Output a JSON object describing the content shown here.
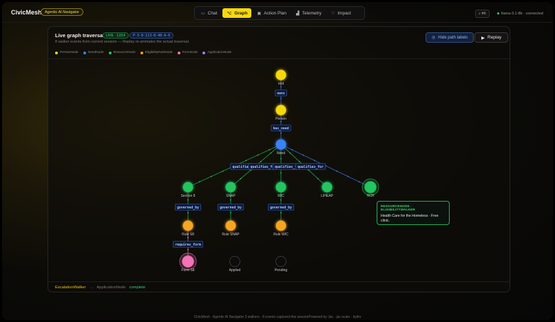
{
  "app": {
    "name": "CivicMesh",
    "badge": "Agentic AI Navigator"
  },
  "nav": {
    "tabs": [
      {
        "label": "Chat",
        "icon": "chat-icon",
        "active": false
      },
      {
        "label": "Graph",
        "icon": "graph-icon",
        "active": true
      },
      {
        "label": "Action Plan",
        "icon": "plan-icon",
        "active": false
      },
      {
        "label": "Telemetry",
        "icon": "bar-chart-icon",
        "active": false
      },
      {
        "label": "Impact",
        "icon": "heart-icon",
        "active": false
      }
    ]
  },
  "shortcut": "⌘K",
  "model_status": "llama-3.1-8b · connected",
  "panel": {
    "title": "Live graph traversal",
    "live_chip": "LIVE · 12/14",
    "id_chip": "P-3-8-113-8-48-A-6",
    "subtitle": "8 walker events from current session — Replay re-animates the actual traversal.",
    "hide_labels_button": "Hide path labels",
    "replay_button": "Replay"
  },
  "legend": [
    {
      "label": "PersonNode",
      "color": "#f5d90a"
    },
    {
      "label": "NeedNode",
      "color": "#3b82f6"
    },
    {
      "label": "ResourceNode",
      "color": "#22c55e"
    },
    {
      "label": "EligibilityRuleNode",
      "color": "#f59e0b"
    },
    {
      "label": "FormNode",
      "color": "#f472b6"
    },
    {
      "label": "ApplicationNode",
      "color": "#8b8bf5"
    }
  ],
  "graph": {
    "nodes": [
      {
        "id": "root",
        "label": "root",
        "kind": "person"
      },
      {
        "id": "person",
        "label": "Person",
        "kind": "person"
      },
      {
        "id": "need",
        "label": "Need",
        "kind": "need"
      },
      {
        "id": "sec8",
        "label": "Section 8",
        "kind": "resource"
      },
      {
        "id": "snap",
        "label": "SNAP",
        "kind": "resource"
      },
      {
        "id": "wic",
        "label": "WIC",
        "kind": "resource"
      },
      {
        "id": "liheap",
        "label": "LIHEAP",
        "kind": "resource"
      },
      {
        "id": "hch",
        "label": "HCH",
        "kind": "resource-active"
      },
      {
        "id": "rule8",
        "label": "Rule S8",
        "kind": "rule"
      },
      {
        "id": "rulesnap",
        "label": "Rule SNAP",
        "kind": "rule"
      },
      {
        "id": "rulewic",
        "label": "Rule WIC",
        "kind": "rule"
      },
      {
        "id": "form8",
        "label": "Form S8",
        "kind": "form-active"
      },
      {
        "id": "applied",
        "label": "Applied",
        "kind": "pending"
      },
      {
        "id": "pending",
        "label": "Pending",
        "kind": "pending"
      }
    ],
    "edge_labels": {
      "root_person": "owns",
      "person_need": "has_need",
      "qualifies": [
        "qualifies_",
        "qualifies_fo",
        "qualifies_f",
        "qualifies_for"
      ],
      "governed_by": "governed_by",
      "requires_form": "requires_form"
    }
  },
  "tooltip": {
    "heading": "RESOURCENODE · ELIGIBILITYWALKER",
    "body": "Health Care for the Homeless · Free clinic."
  },
  "status": {
    "walker": "EscalationWalker",
    "arrow": "→",
    "node": "ApplicationNode",
    "state": "complete"
  },
  "footer": "CivicMesh · Agentic AI Navigator          3 walkers · 8 events captured this sessionPowered by Jac · jac-scale · byllm"
}
